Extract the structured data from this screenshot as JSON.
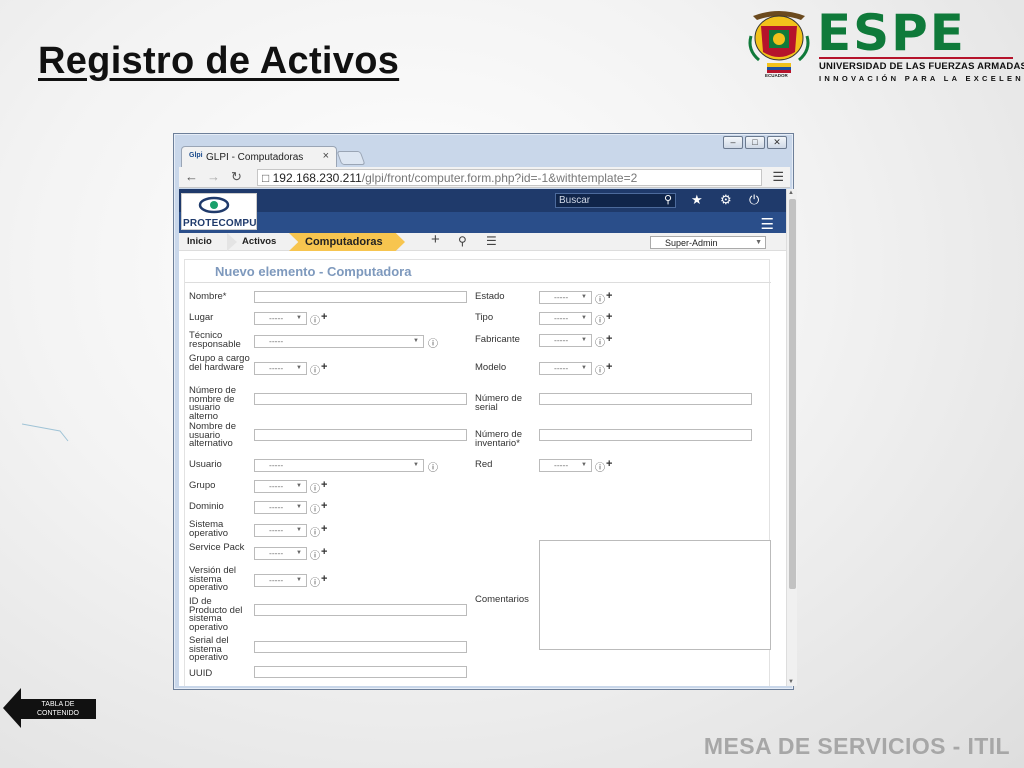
{
  "slide": {
    "title": "Registro de Activos",
    "footer": "MESA DE SERVICIOS - ITIL",
    "back_button": "TABLA DE CONTENIDO"
  },
  "logo": {
    "wordmark": "ESPE",
    "subtitle": "UNIVERSIDAD DE LAS FUERZAS ARMADAS",
    "tagline": "INNOVACIÓN PARA LA EXCELENCIA",
    "crest_caption": "ECUADOR",
    "green": "#0f7a3a",
    "red": "#b5132b"
  },
  "browser": {
    "tab_title": "GLPI - Computadoras",
    "tab_favicon": "Glpi",
    "url_host": "192.168.230.211",
    "url_path": "/glpi/front/computer.form.php?id=-1&withtemplate=2"
  },
  "glpi": {
    "brand": "PROTECOMPU",
    "search_placeholder": "Buscar",
    "header_color": "#1f3a6b",
    "breadcrumb": [
      "Inicio",
      "Activos"
    ],
    "breadcrumb_active": "Computadoras",
    "breadcrumb_active_color": "#f7c54f",
    "profile": "Super-Admin",
    "form_title": "Nuevo elemento - Computadora",
    "empty_option": "-----",
    "labels": {
      "nombre": "Nombre*",
      "lugar": "Lugar",
      "tecnico": "Técnico responsable",
      "grupo_hw": "Grupo a cargo del hardware",
      "num_usuario_alterno": "Número de nombre de usuario alterno",
      "nombre_usuario_alt": "Nombre de usuario alternativo",
      "usuario": "Usuario",
      "grupo": "Grupo",
      "dominio": "Dominio",
      "sistema_operativo": "Sistema operativo",
      "service_pack": "Service Pack",
      "version_so": "Versión del sistema operativo",
      "id_producto_so": "ID de Producto del sistema operativo",
      "serial_so": "Serial del sistema operativo",
      "uuid": "UUID",
      "estado": "Estado",
      "tipo": "Tipo",
      "fabricante": "Fabricante",
      "modelo": "Modelo",
      "numero_serial": "Número de serial",
      "numero_inventario": "Número de inventario*",
      "red": "Red",
      "comentarios": "Comentarios"
    }
  }
}
